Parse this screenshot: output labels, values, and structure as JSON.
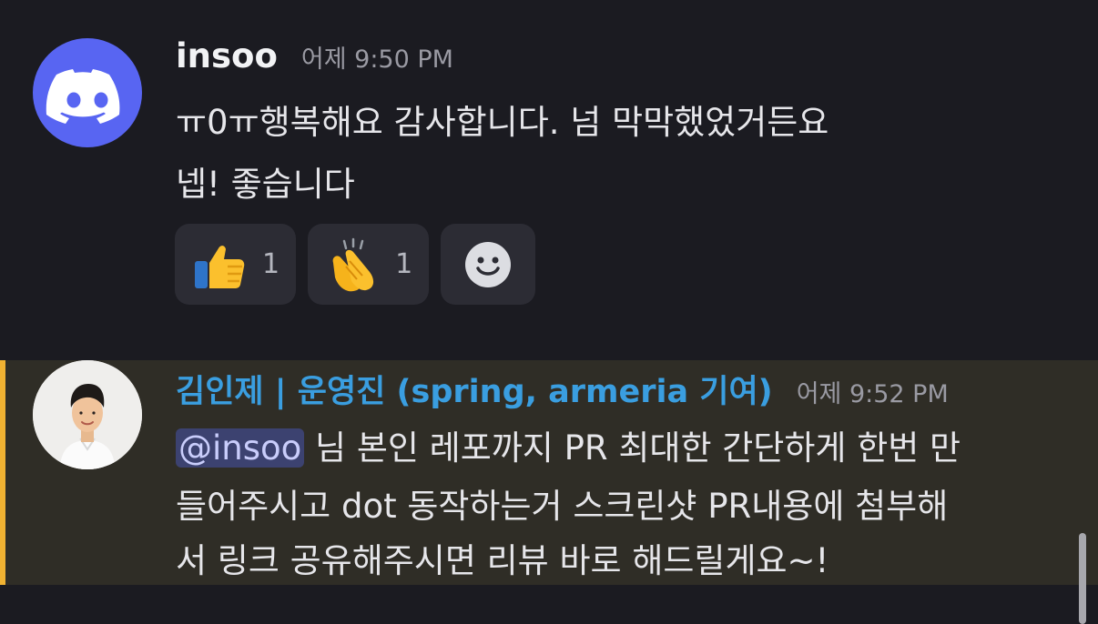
{
  "messages": [
    {
      "username": "insoo",
      "timestamp": "어제 9:50 PM",
      "avatar_icon": "discord-logo-icon",
      "lines": [
        "ㅠ0ㅠ행복해요 감사합니다. 넘 막막했었거든요",
        "넵! 좋습니다"
      ],
      "reactions": [
        {
          "emoji": "thumbs-up-icon",
          "count": "1"
        },
        {
          "emoji": "clapping-hands-icon",
          "count": "1"
        }
      ],
      "add_reaction_icon": "smiley-face-icon"
    },
    {
      "username": "김인제 | 운영진 (spring, armeria 기여)",
      "timestamp": "어제 9:52 PM",
      "avatar_icon": "profile-photo",
      "mention": "@insoo",
      "line1_rest": " 님 본인 레포까지 PR 최대한 간단하게 한번 만",
      "line2": "들어주시고 dot 동작하는거 스크린샷 PR내용에 첨부해",
      "line3": "서 링크 공유해주시면 리뷰 바로 해드릴게요~!"
    }
  ],
  "colors": {
    "background": "#1b1b21",
    "mention_highlight": "#2f2d26",
    "mention_bar": "#f0b232",
    "discord_blurple": "#5865f2",
    "username_blue": "#3a9ee0"
  }
}
